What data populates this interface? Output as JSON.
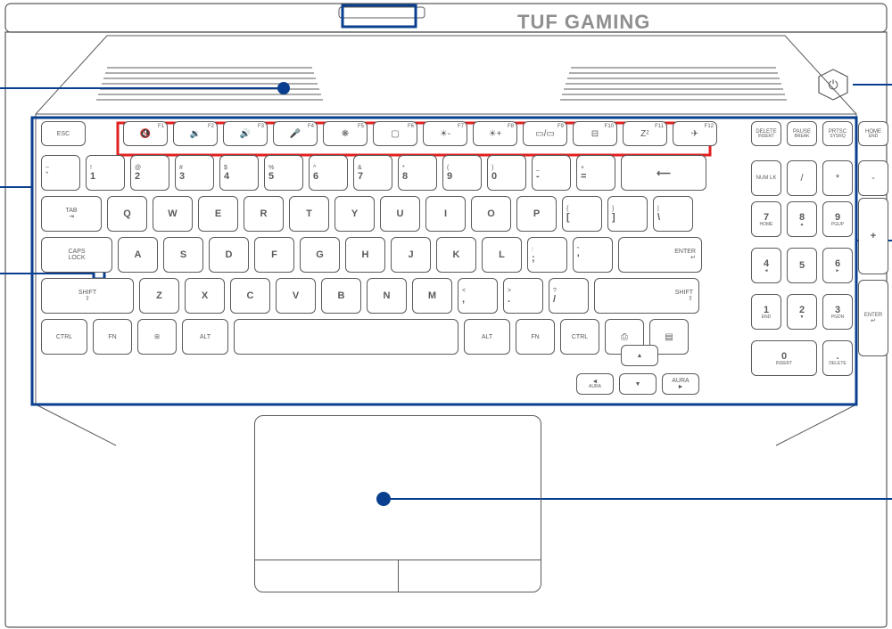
{
  "brand": "TUF GAMING",
  "status_icons": [
    "power-led",
    "battery-led",
    "drive-led",
    "airplane-led"
  ],
  "power_button_icon": "⏻",
  "keys": {
    "esc": "ESC",
    "fn_row": [
      {
        "sec": "F1",
        "ico": "🔇"
      },
      {
        "sec": "F2",
        "ico": "🔉"
      },
      {
        "sec": "F3",
        "ico": "🔊"
      },
      {
        "sec": "F4",
        "ico": "🎤"
      },
      {
        "sec": "F5",
        "ico": "❋"
      },
      {
        "sec": "F6",
        "ico": "▢"
      },
      {
        "sec": "F7",
        "ico": "☀-"
      },
      {
        "sec": "F8",
        "ico": "☀+"
      },
      {
        "sec": "F9",
        "ico": "▭/▭"
      },
      {
        "sec": "F10",
        "ico": "⊟"
      },
      {
        "sec": "F11",
        "ico": "Zᶻ"
      },
      {
        "sec": "F12",
        "ico": "✈"
      }
    ],
    "row1": [
      {
        "u": "~",
        "l": "`"
      },
      {
        "u": "!",
        "l": "1"
      },
      {
        "u": "@",
        "l": "2"
      },
      {
        "u": "#",
        "l": "3"
      },
      {
        "u": "$",
        "l": "4"
      },
      {
        "u": "%",
        "l": "5"
      },
      {
        "u": "^",
        "l": "6"
      },
      {
        "u": "&",
        "l": "7"
      },
      {
        "u": "*",
        "l": "8"
      },
      {
        "u": "(",
        "l": "9"
      },
      {
        "u": ")",
        "l": "0"
      },
      {
        "u": "_",
        "l": "-"
      },
      {
        "u": "+",
        "l": "="
      }
    ],
    "backspace": "⟵",
    "tab": "TAB",
    "tab_sub": "⇥",
    "row2": [
      "Q",
      "W",
      "E",
      "R",
      "T",
      "Y",
      "U",
      "I",
      "O",
      "P"
    ],
    "row2_end": [
      {
        "u": "{",
        "l": "["
      },
      {
        "u": "}",
        "l": "]"
      },
      {
        "u": "|",
        "l": "\\"
      }
    ],
    "caps": "CAPS LOCK",
    "row3": [
      "A",
      "S",
      "D",
      "F",
      "G",
      "H",
      "J",
      "K",
      "L"
    ],
    "row3_end": [
      {
        "u": ":",
        "l": ";"
      },
      {
        "u": "\"",
        "l": "'"
      }
    ],
    "enter": "ENTER",
    "enter_sub": "↵",
    "shift": "SHIFT",
    "shift_sub": "⇧",
    "row4": [
      "Z",
      "X",
      "C",
      "V",
      "B",
      "N",
      "M"
    ],
    "row4_end": [
      {
        "u": "<",
        "l": ","
      },
      {
        "u": ">",
        "l": "."
      },
      {
        "u": "?",
        "l": "/"
      }
    ],
    "ctrl": "CTRL",
    "fn": "FN",
    "win": "⊞",
    "alt": "ALT",
    "menu": "▤",
    "prtsc": "⎙",
    "arrows": {
      "up": "▲",
      "down": "▼",
      "left": "◄",
      "right": "►",
      "aura_l": "AURA",
      "aura_r": "AURA"
    },
    "numpad": {
      "top": [
        {
          "m": "DELETE",
          "s": "INSERT"
        },
        {
          "m": "PAUSE",
          "s": "BREAK"
        },
        {
          "m": "PRTSC",
          "s": "SYSRQ"
        },
        {
          "m": "HOME",
          "s": "END"
        }
      ],
      "r1": [
        "NUM LK",
        "/",
        "*",
        "-"
      ],
      "r2": [
        {
          "m": "7",
          "s": "HOME"
        },
        {
          "m": "8",
          "s": "▲"
        },
        {
          "m": "9",
          "s": "PGUP"
        }
      ],
      "plus": "+",
      "r3": [
        {
          "m": "4",
          "s": "◄"
        },
        {
          "m": "5",
          "s": ""
        },
        {
          "m": "6",
          "s": "►"
        }
      ],
      "r4": [
        {
          "m": "1",
          "s": "END"
        },
        {
          "m": "2",
          "s": "▼"
        },
        {
          "m": "3",
          "s": "PGDN"
        }
      ],
      "enter": "ENTER",
      "enter_sub": "↵",
      "r5": [
        {
          "m": "0",
          "s": "INSERT"
        },
        {
          "m": ".",
          "s": "DELETE"
        }
      ]
    }
  }
}
